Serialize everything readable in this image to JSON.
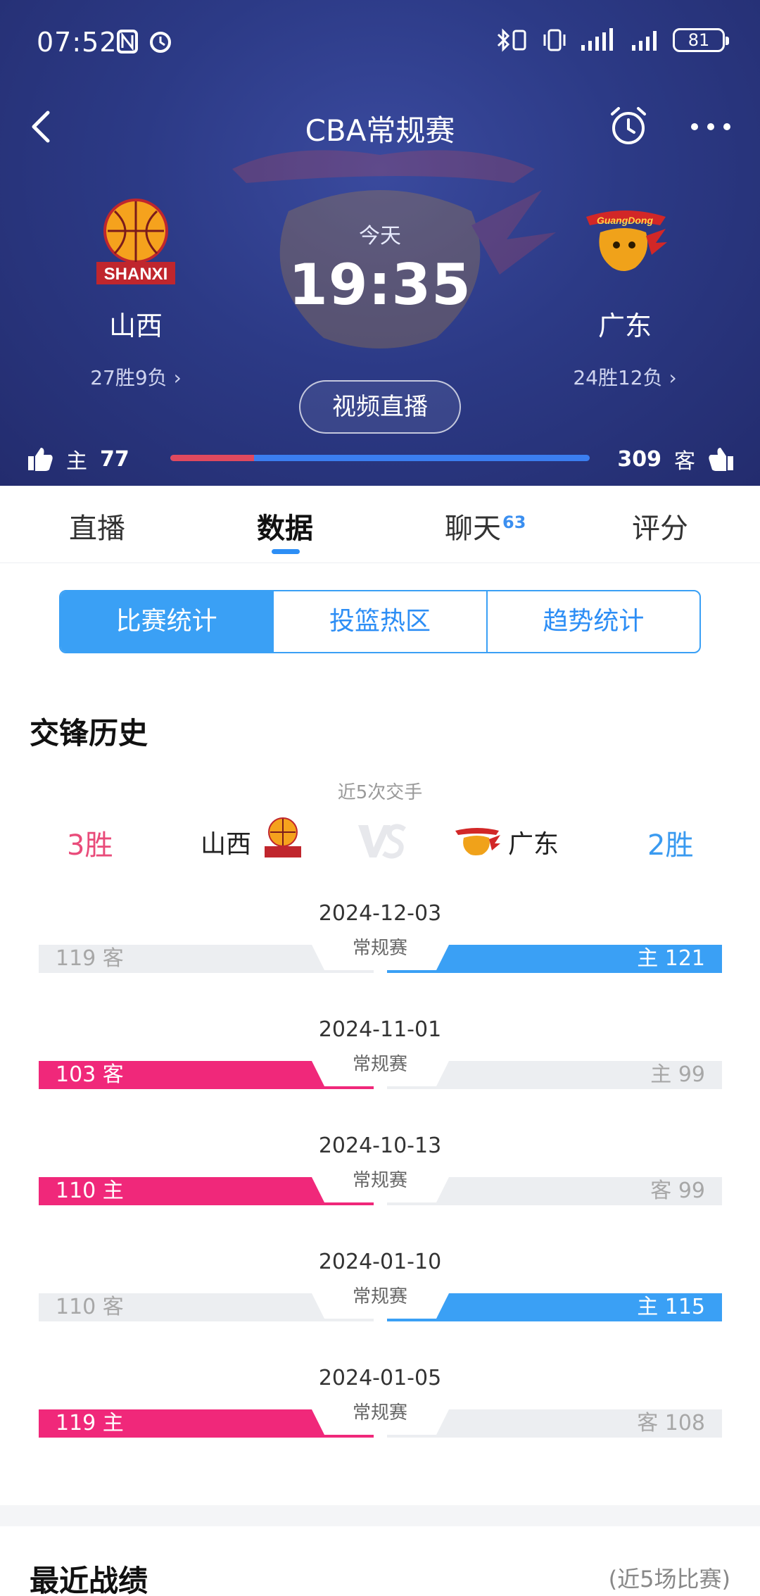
{
  "status": {
    "time": "07:52",
    "battery": "81"
  },
  "nav": {
    "title": "CBA常规赛"
  },
  "match": {
    "home": {
      "name": "山西",
      "record": "27胜9负",
      "logo_text": "SHANXI"
    },
    "away": {
      "name": "广东",
      "record": "24胜12负",
      "logo_text": "GuangDong"
    },
    "day": "今天",
    "time": "19:35",
    "video_label": "视频直播"
  },
  "votes": {
    "home_label": "主",
    "home_count": "77",
    "away_label": "客",
    "away_count": "309",
    "home_share": 0.2
  },
  "tabs": [
    {
      "label": "直播"
    },
    {
      "label": "数据"
    },
    {
      "label": "聊天",
      "badge": "63"
    },
    {
      "label": "评分"
    }
  ],
  "segments": [
    {
      "label": "比赛统计"
    },
    {
      "label": "投篮热区"
    },
    {
      "label": "趋势统计"
    }
  ],
  "h2h": {
    "title": "交锋历史",
    "subtitle": "近5次交手",
    "home_wins": "3胜",
    "away_wins": "2胜",
    "home_name": "山西",
    "away_name": "广东",
    "matches": [
      {
        "date": "2024-12-03",
        "type": "常规赛",
        "left": "119 客",
        "right": "主 121",
        "winner": "away"
      },
      {
        "date": "2024-11-01",
        "type": "常规赛",
        "left": "103 客",
        "right": "主 99",
        "winner": "home"
      },
      {
        "date": "2024-10-13",
        "type": "常规赛",
        "left": "110 主",
        "right": "客 99",
        "winner": "home"
      },
      {
        "date": "2024-01-10",
        "type": "常规赛",
        "left": "110 客",
        "right": "主 115",
        "winner": "away"
      },
      {
        "date": "2024-01-05",
        "type": "常规赛",
        "left": "119 主",
        "right": "客 108",
        "winner": "home"
      }
    ]
  },
  "recent": {
    "title": "最近战绩",
    "note": "(近5场比赛)"
  },
  "colors": {
    "header_bg": "#2c3a86",
    "accent_blue": "#3aa0f5",
    "home_win": "#f0287a"
  }
}
